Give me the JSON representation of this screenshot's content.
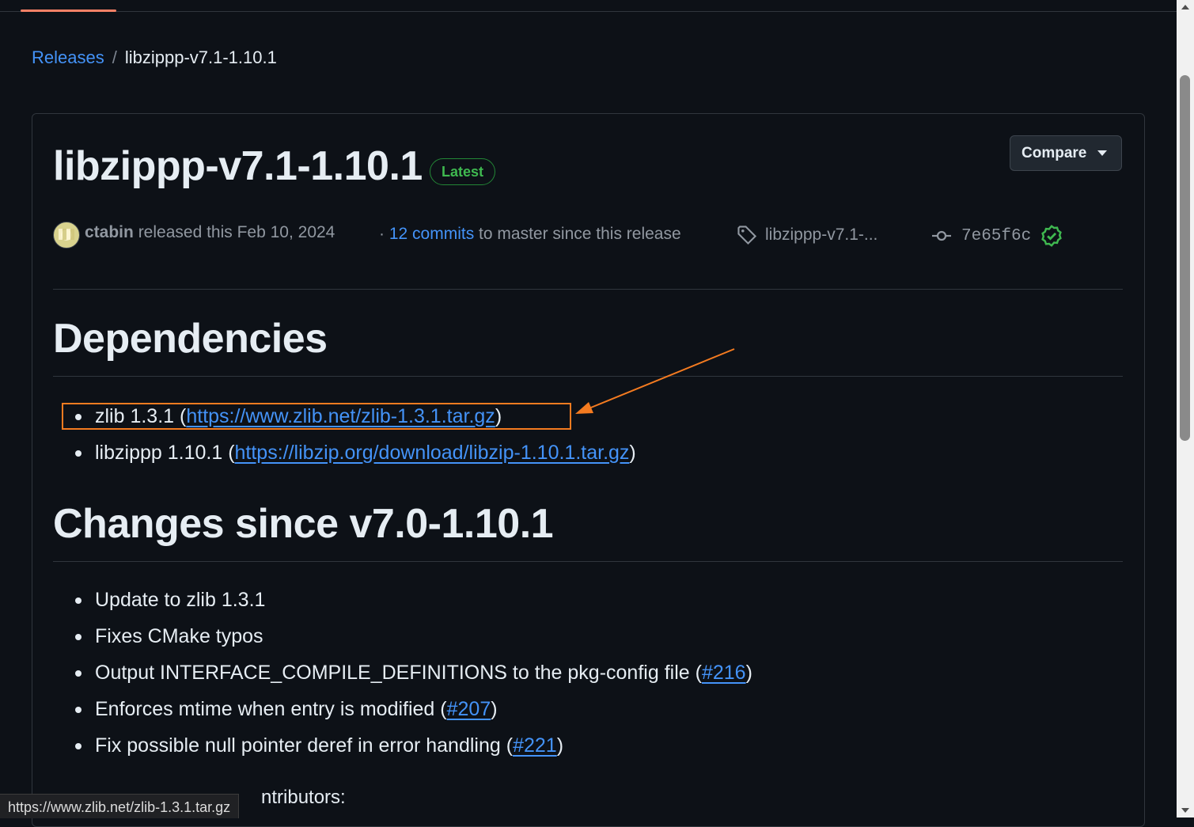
{
  "breadcrumb": {
    "parent": "Releases",
    "separator": "/",
    "current": "libzippp-v7.1-1.10.1"
  },
  "release": {
    "title": "libzippp-v7.1-1.10.1",
    "badge": "Latest",
    "compare_label": "Compare",
    "author": "ctabin",
    "released_text": "released this Feb 10, 2024",
    "commits_prefix": "·",
    "commits_link": "12 commits",
    "commits_suffix": "to master since this release",
    "tag": "libzippp-v7.1-...",
    "commit_sha": "7e65f6c"
  },
  "dependencies": {
    "heading": "Dependencies",
    "items": [
      {
        "name": "zlib 1.3.1",
        "open": "(",
        "url": "https://www.zlib.net/zlib-1.3.1.tar.gz",
        "close": ")"
      },
      {
        "name": "libzippp 1.10.1",
        "open": "(",
        "url": "https://libzip.org/download/libzip-1.10.1.tar.gz",
        "close": ")"
      }
    ]
  },
  "changes": {
    "heading": "Changes since v7.0-1.10.1",
    "items": [
      {
        "text": "Update to zlib 1.3.1"
      },
      {
        "text": "Fixes CMake typos"
      },
      {
        "text": "Output INTERFACE_COMPILE_DEFINITIONS to the pkg-config file",
        "open": "(",
        "link": "#216",
        "close": ")"
      },
      {
        "text": "Enforces mtime when entry is modified",
        "open": "(",
        "link": "#207",
        "close": ")"
      },
      {
        "text": "Fix possible null pointer deref in error handling",
        "open": "(",
        "link": "#221",
        "close": ")"
      }
    ]
  },
  "contributors_partial": "ntributors:",
  "status_bar": "https://www.zlib.net/zlib-1.3.1.tar.gz",
  "colors": {
    "background": "#0d1117",
    "link": "#4493f8",
    "badge": "#3fb950",
    "annotation": "#f47b20",
    "verified": "#3fb950"
  }
}
